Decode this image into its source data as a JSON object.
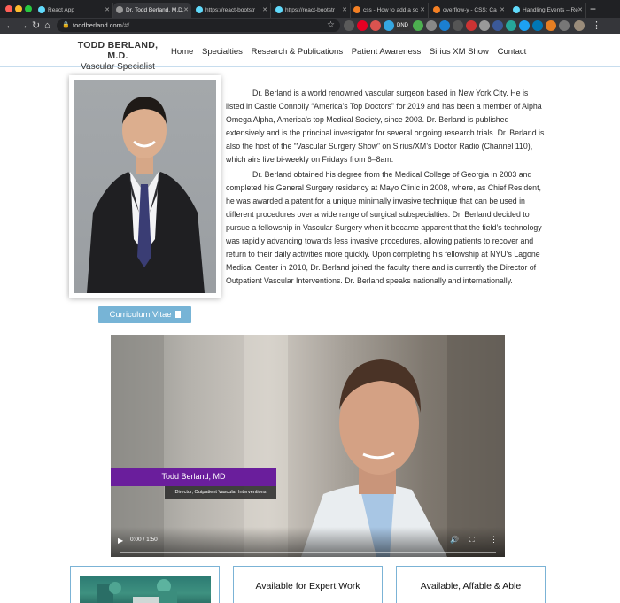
{
  "browser": {
    "tabs": [
      {
        "title": "React App",
        "active": false
      },
      {
        "title": "Dr. Todd Berland, M.D.",
        "active": true
      },
      {
        "title": "https://react-bootstr",
        "active": false
      },
      {
        "title": "https://react-bootstr",
        "active": false
      },
      {
        "title": "css - How to add a sc",
        "active": false
      },
      {
        "title": "overflow-y - CSS: Ca",
        "active": false
      },
      {
        "title": "Handling Events – Re",
        "active": false
      }
    ],
    "url_host": "toddberland.com",
    "url_path": "/#/",
    "icons": [
      "back-icon",
      "forward-icon",
      "reload-icon",
      "home-icon",
      "lock-icon",
      "star-icon",
      "new-tab-icon"
    ],
    "ext_badge": "DND"
  },
  "site": {
    "brand_name": "TODD BERLAND, M.D.",
    "brand_sub": "Vascular Specialist",
    "nav": [
      "Home",
      "Specialties",
      "Research & Publications",
      "Patient Awareness",
      "Sirius XM Show",
      "Contact"
    ]
  },
  "bio": {
    "p1": "Dr. Berland is a world renowned vascular surgeon based in New York City. He is listed in Castle Connolly “America’s Top Doctors” for 2019 and has been a member of Alpha Omega Alpha, America’s top Medical Society, since 2003. Dr. Berland is published extensively and is the principal investigator for several ongoing research trials. Dr. Berland is also the host of the “Vascular Surgery Show” on Sirius/XM’s Doctor Radio (Channel 110), which airs live bi-weekly on Fridays from 6–8am.",
    "p2": "Dr. Berland obtained his degree from the Medical College of Georgia in 2003 and completed his General Surgery residency at Mayo Clinic in 2008, where, as Chief Resident, he was awarded a patent for a unique minimally invasive technique that can be used in different procedures over a wide range of surgical subspecialties. Dr. Berland decided to pursue a fellowship in Vascular Surgery when it became apparent that the field’s technology was rapidly advancing towards less invasive procedures, allowing patients to recover and return to their daily activities more quickly. Upon completing his fellowship at NYU’s Lagone Medical Center in 2010, Dr. Berland joined the faculty there and is currently the Director of Outpatient Vascular Interventions. Dr. Berland speaks nationally and internationally."
  },
  "cv_button": {
    "label": "Curriculum Vitae",
    "icon": "document-icon"
  },
  "video": {
    "lower_third_name": "Todd Berland, MD",
    "lower_third_title": "Director, Outpatient Vascular Interventions",
    "time": "0:00 / 1:50",
    "accent_color": "#6a1e9c"
  },
  "cards": [
    {
      "title": "",
      "has_image": true
    },
    {
      "title": "Available for Expert Work"
    },
    {
      "title": "Available, Affable & Able"
    }
  ],
  "colors": {
    "button": "#77b4d6",
    "card_border": "#7bb3d6",
    "chrome_dark": "#202124"
  }
}
